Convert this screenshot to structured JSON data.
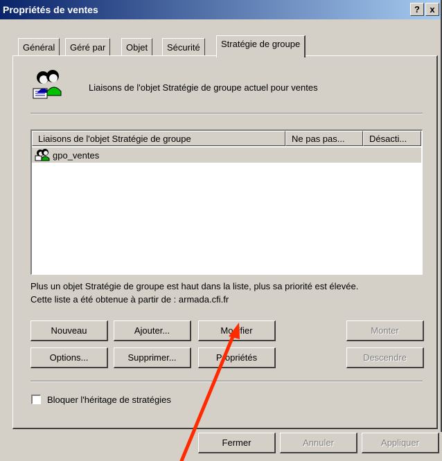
{
  "window": {
    "title": "Propriétés de ventes",
    "help_label": "?",
    "close_label": "x"
  },
  "tabs": [
    {
      "label": "Général"
    },
    {
      "label": "Géré par"
    },
    {
      "label": "Objet"
    },
    {
      "label": "Sécurité"
    },
    {
      "label": "Stratégie de groupe",
      "active": true
    }
  ],
  "header": {
    "text": "Liaisons de l'objet Stratégie de groupe actuel pour ventes"
  },
  "list": {
    "columns": [
      "Liaisons de l'objet Stratégie de groupe",
      "Ne pas pas...",
      "Désacti..."
    ],
    "rows": [
      {
        "name": "gpo_ventes"
      }
    ]
  },
  "info": {
    "line1": "Plus un objet Stratégie de groupe est haut dans la liste, plus sa priorité est élevée.",
    "line2": "Cette liste a été obtenue à partir de : armada.cfi.fr"
  },
  "buttons": {
    "nouveau": "Nouveau",
    "ajouter": "Ajouter...",
    "modifier": "Modifier",
    "monter": "Monter",
    "options": "Options...",
    "supprimer": "Supprimer...",
    "proprietes": "Propriétés",
    "descendre": "Descendre"
  },
  "checkbox": {
    "label": "Bloquer l'héritage de stratégies",
    "checked": false
  },
  "footer": {
    "fermer": "Fermer",
    "annuler": "Annuler",
    "appliquer": "Appliquer"
  },
  "colors": {
    "dialog": "#d4d0c8",
    "title_start": "#0a246a",
    "title_end": "#a6caf0",
    "annotation_arrow": "#ff2a00"
  },
  "icons": [
    "group-policy-users-icon",
    "gpo-link-icon"
  ]
}
